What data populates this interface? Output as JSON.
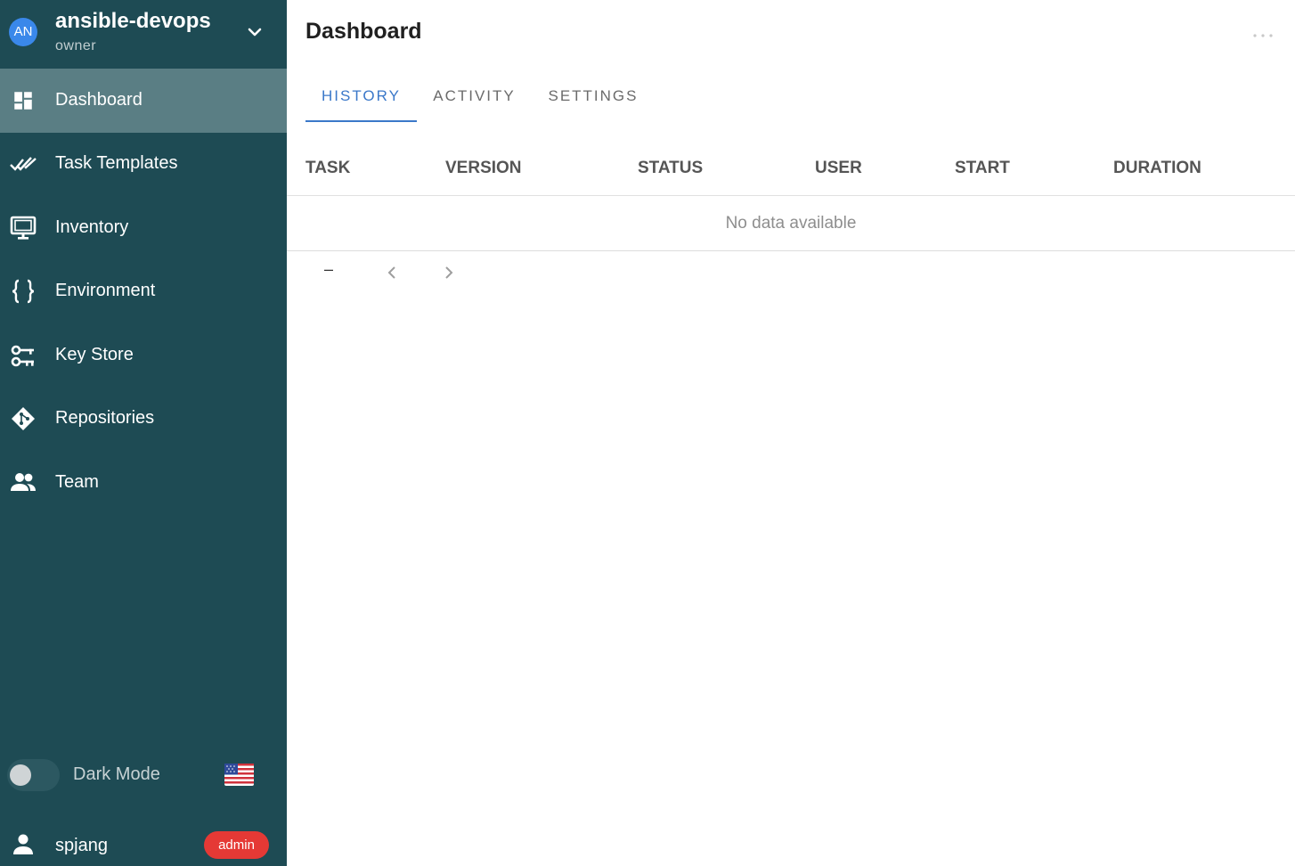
{
  "project": {
    "avatar_initials": "AN",
    "name": "ansible-devops",
    "role": "owner"
  },
  "sidebar": {
    "items": [
      {
        "label": "Dashboard",
        "icon": "dashboard-icon",
        "active": true
      },
      {
        "label": "Task Templates",
        "icon": "done-all-icon",
        "active": false
      },
      {
        "label": "Inventory",
        "icon": "monitor-icon",
        "active": false
      },
      {
        "label": "Environment",
        "icon": "code-braces-icon",
        "active": false
      },
      {
        "label": "Key Store",
        "icon": "key-change-icon",
        "active": false
      },
      {
        "label": "Repositories",
        "icon": "git-icon",
        "active": false
      },
      {
        "label": "Team",
        "icon": "account-multiple-icon",
        "active": false
      }
    ],
    "dark_mode": {
      "label": "Dark Mode",
      "enabled": false
    },
    "language_flag": "us-flag-icon",
    "user": {
      "name": "spjang",
      "badge": "admin"
    }
  },
  "main": {
    "title": "Dashboard",
    "tabs": [
      {
        "label": "HISTORY",
        "active": true
      },
      {
        "label": "ACTIVITY",
        "active": false
      },
      {
        "label": "SETTINGS",
        "active": false
      }
    ],
    "table": {
      "columns": [
        "TASK",
        "VERSION",
        "STATUS",
        "USER",
        "START",
        "DURATION"
      ],
      "empty_text": "No data available"
    },
    "pagination": {
      "range_text": "–"
    }
  },
  "colors": {
    "sidebar_bg": "#1e4b54",
    "sidebar_active_bg": "#5a7e84",
    "accent": "#3b78c9",
    "badge_red": "#e53935",
    "avatar_blue": "#3a88ea"
  }
}
